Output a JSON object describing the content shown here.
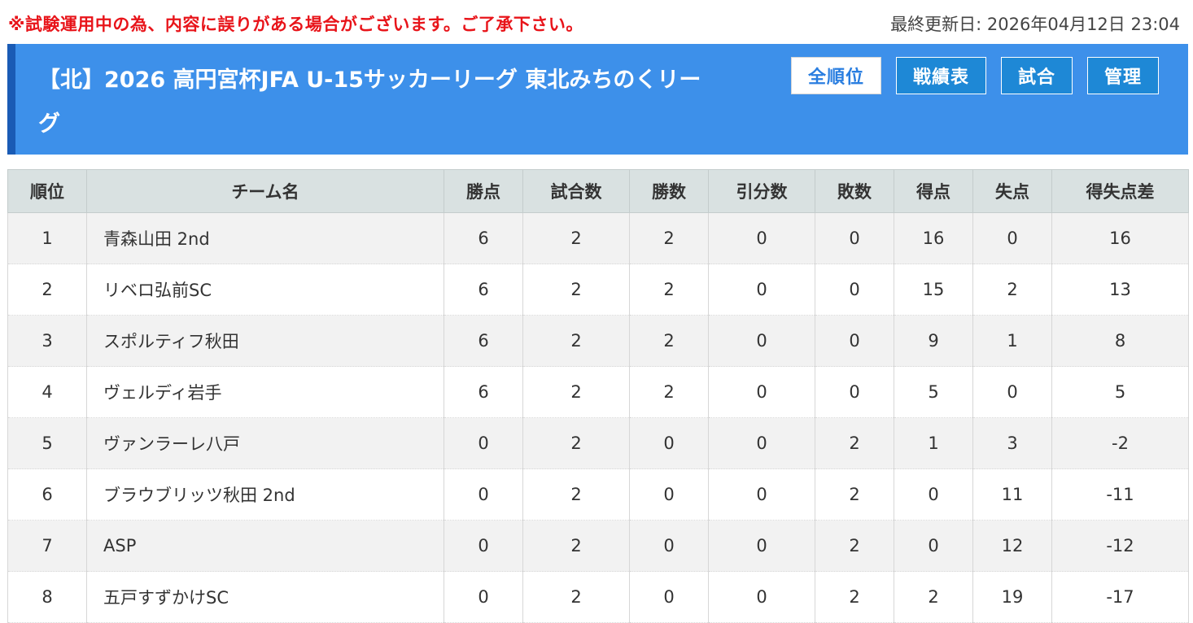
{
  "notice": "※試験運用中の為、内容に誤りがある場合がございます。ご了承下さい。",
  "last_updated": "最終更新日: 2026年04月12日 23:04",
  "league_title": "【北】2026 高円宮杯JFA U-15サッカーリーグ 東北みちのくリーグ",
  "nav": {
    "standings": "全順位",
    "results_table": "戦績表",
    "matches": "試合",
    "admin": "管理"
  },
  "colors": {
    "notice": "#e8141a",
    "header_bg": "#3d90ea",
    "header_accent": "#1a5bb5",
    "table_header_bg": "#d9e1e1"
  },
  "table": {
    "headers": {
      "rank": "順位",
      "team": "チーム名",
      "points": "勝点",
      "played": "試合数",
      "won": "勝数",
      "drawn": "引分数",
      "lost": "敗数",
      "gf": "得点",
      "ga": "失点",
      "gd": "得失点差"
    },
    "rows": [
      {
        "rank": "1",
        "team": "青森山田 2nd",
        "points": "6",
        "played": "2",
        "won": "2",
        "drawn": "0",
        "lost": "0",
        "gf": "16",
        "ga": "0",
        "gd": "16"
      },
      {
        "rank": "2",
        "team": "リベロ弘前SC",
        "points": "6",
        "played": "2",
        "won": "2",
        "drawn": "0",
        "lost": "0",
        "gf": "15",
        "ga": "2",
        "gd": "13"
      },
      {
        "rank": "3",
        "team": "スポルティフ秋田",
        "points": "6",
        "played": "2",
        "won": "2",
        "drawn": "0",
        "lost": "0",
        "gf": "9",
        "ga": "1",
        "gd": "8"
      },
      {
        "rank": "4",
        "team": "ヴェルディ岩手",
        "points": "6",
        "played": "2",
        "won": "2",
        "drawn": "0",
        "lost": "0",
        "gf": "5",
        "ga": "0",
        "gd": "5"
      },
      {
        "rank": "5",
        "team": "ヴァンラーレ八戸",
        "points": "0",
        "played": "2",
        "won": "0",
        "drawn": "0",
        "lost": "2",
        "gf": "1",
        "ga": "3",
        "gd": "-2"
      },
      {
        "rank": "6",
        "team": "ブラウブリッツ秋田 2nd",
        "points": "0",
        "played": "2",
        "won": "0",
        "drawn": "0",
        "lost": "2",
        "gf": "0",
        "ga": "11",
        "gd": "-11"
      },
      {
        "rank": "7",
        "team": "ASP",
        "points": "0",
        "played": "2",
        "won": "0",
        "drawn": "0",
        "lost": "2",
        "gf": "0",
        "ga": "12",
        "gd": "-12"
      },
      {
        "rank": "8",
        "team": "五戸すずかけSC",
        "points": "0",
        "played": "2",
        "won": "0",
        "drawn": "0",
        "lost": "2",
        "gf": "2",
        "ga": "19",
        "gd": "-17"
      }
    ]
  }
}
